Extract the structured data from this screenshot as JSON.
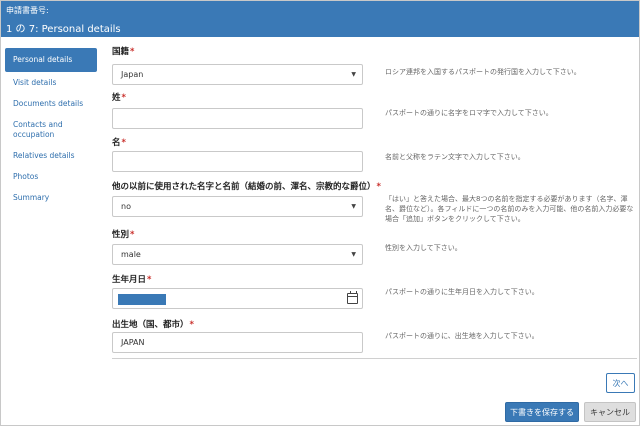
{
  "header": {
    "application_number_label": "申請書番号:",
    "step_label": "1 の 7: Personal details"
  },
  "sidebar": {
    "items": [
      {
        "label": "Personal details"
      },
      {
        "label": "Visit details"
      },
      {
        "label": "Documents details"
      },
      {
        "label": "Contacts and occupation"
      },
      {
        "label": "Relatives details"
      },
      {
        "label": "Photos"
      },
      {
        "label": "Summary"
      }
    ]
  },
  "form": {
    "nationality": {
      "label": "国籍",
      "value": "Japan",
      "help": "ロシア連邦を入国するパスポートの発行国を入力して下さい。"
    },
    "surname": {
      "label": "姓",
      "value": "",
      "help": "パスポートの通りに名字をロマ字で入力して下さい。"
    },
    "given_name": {
      "label": "名",
      "value": "",
      "help": "名前と父称をラテン文字で入力して下さい。"
    },
    "other_names": {
      "label": "他の以前に使用された名字と名前（結婚の前、渾名、宗教的な爵位）",
      "value": "no",
      "help": "「はい」と答えた場合、最大8つの名前を指定する必要があります（名字、渾名、爵位など）。各フィルドに一つの名前のみを入力可能、他の名前入力必要な場合「追加」ボタンをクリックして下さい。"
    },
    "gender": {
      "label": "性別",
      "value": "male",
      "help": "性別を入力して下さい。"
    },
    "birth_date": {
      "label": "生年月日",
      "help": "パスポートの通りに生年月日を入力して下さい。"
    },
    "birth_place": {
      "label": "出生地（国、都市）",
      "value": "JAPAN",
      "help": "パスポートの通りに、出生地を入力して下さい。"
    },
    "required_mark": "*"
  },
  "buttons": {
    "next": "次へ",
    "save_draft": "下書きを保存する",
    "cancel": "キャンセル"
  },
  "icons": {
    "dropdown": "chevron-down-icon",
    "calendar": "calendar-icon"
  },
  "colors": {
    "accent": "#3a79b6",
    "required": "#c9302c"
  }
}
